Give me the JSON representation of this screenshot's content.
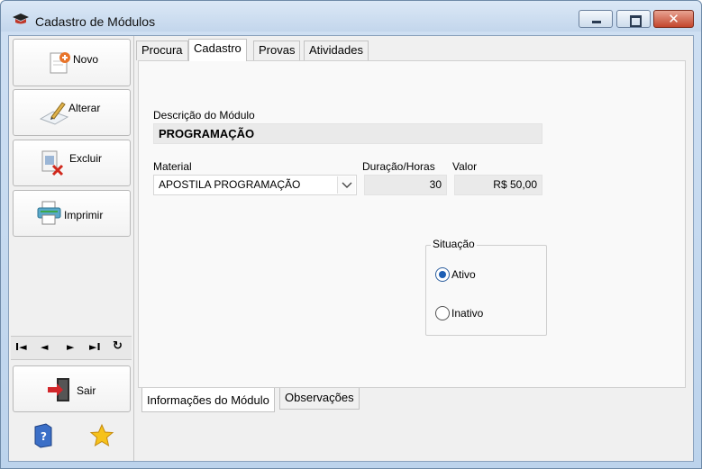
{
  "window": {
    "title": "Cadastro de Módulos",
    "close_glyph": "✕"
  },
  "sidebar": {
    "novo": "Novo",
    "alterar": "Alterar",
    "excluir": "Excluir",
    "imprimir": "Imprimir",
    "sair": "Sair",
    "nav": {
      "first": "I◄",
      "prev": "◄",
      "next": "►",
      "last": "►I",
      "refresh": "↻"
    }
  },
  "tabs_top": [
    "Procura",
    "Cadastro",
    "Provas",
    "Atividades"
  ],
  "form": {
    "descricao_label": "Descrição do Módulo",
    "descricao_value": "PROGRAMAÇÃO",
    "material_label": "Material",
    "material_value": "APOSTILA PROGRAMAÇÃO",
    "duracao_label": "Duração/Horas",
    "duracao_value": "30",
    "valor_label": "Valor",
    "valor_value": "R$ 50,00",
    "situacao_label": "Situação",
    "ativo_label": "Ativo",
    "inativo_label": "Inativo"
  },
  "tabs_bottom": [
    "Informações do Módulo",
    "Observações"
  ],
  "colors": {
    "radio_selected": "#1d5fb5",
    "close_button": "#c3452c"
  }
}
